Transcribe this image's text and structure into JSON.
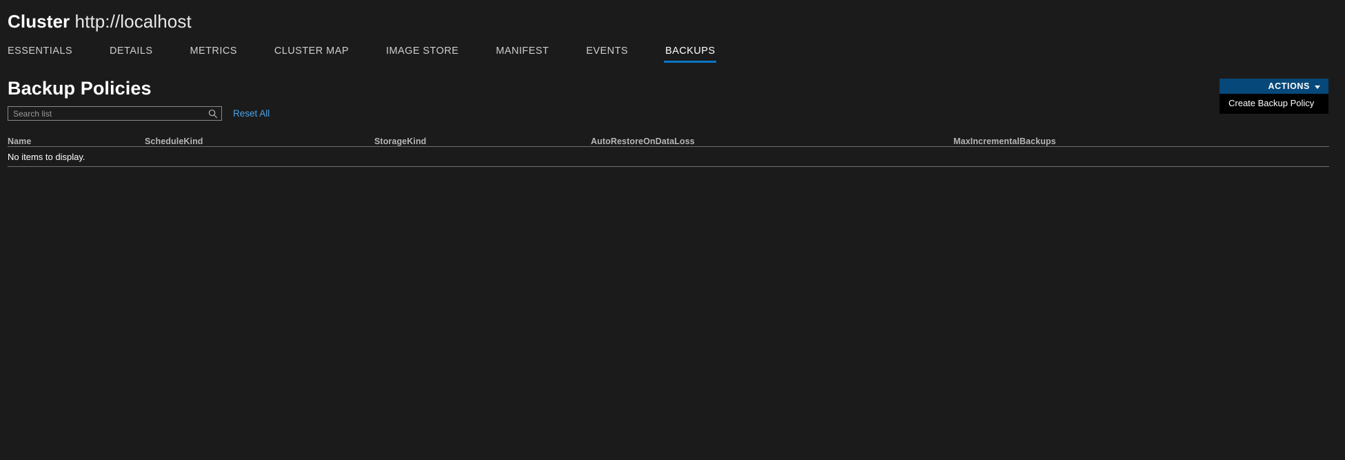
{
  "header": {
    "entity_label": "Cluster",
    "entity_url": "http://localhost"
  },
  "tabs": [
    {
      "label": "ESSENTIALS",
      "active": false
    },
    {
      "label": "DETAILS",
      "active": false
    },
    {
      "label": "METRICS",
      "active": false
    },
    {
      "label": "CLUSTER MAP",
      "active": false
    },
    {
      "label": "IMAGE STORE",
      "active": false
    },
    {
      "label": "MANIFEST",
      "active": false
    },
    {
      "label": "EVENTS",
      "active": false
    },
    {
      "label": "BACKUPS",
      "active": true
    }
  ],
  "actions": {
    "button_label": "ACTIONS",
    "caret_icon": "chevron-down-icon",
    "menu_open": true,
    "menu_items": [
      {
        "label": "Create Backup Policy"
      }
    ]
  },
  "main": {
    "section_title": "Backup Policies",
    "search": {
      "value": "",
      "placeholder": "Search list",
      "icon": "search-icon"
    },
    "reset_label": "Reset All",
    "table": {
      "columns": [
        "Name",
        "ScheduleKind",
        "StorageKind",
        "AutoRestoreOnDataLoss",
        "MaxIncrementalBackups"
      ],
      "rows": [],
      "empty_message": "No items to display."
    }
  },
  "colors": {
    "background": "#1b1b1b",
    "accent_blue": "#0a76c8",
    "button_blue": "#06487a",
    "link_blue": "#4aa3e8",
    "menu_background": "#000000",
    "divider": "#6e6e6e"
  }
}
